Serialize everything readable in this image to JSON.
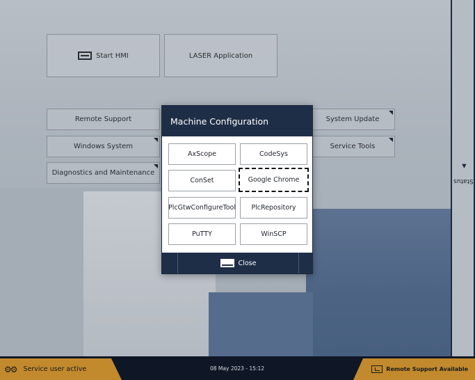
{
  "main_tiles": {
    "start_hmi": "Start HMI",
    "laser_application": "LASER Application"
  },
  "left_menu": {
    "remote_support": "Remote Support",
    "windows_system": "Windows System",
    "diagnostics": "Diagnostics and Maintenance"
  },
  "right_menu": {
    "system_update": "System Update",
    "service_tools": "Service Tools"
  },
  "dialog": {
    "title": "Machine Configuration",
    "buttons": [
      "AxScope",
      "CodeSys",
      "ConSet",
      "Google Chrome",
      "PlcGtwConfigureTool",
      "PlcRepository",
      "PuTTY",
      "WinSCP"
    ],
    "close_label": "Close"
  },
  "side_panel": {
    "status_label": "Status"
  },
  "status_bar": {
    "service_user": "Service user active",
    "datetime": "08 May 2023 - 15:12",
    "remote_support": "Remote Support Available"
  },
  "colors": {
    "accent_orange": "#c28a2d",
    "header_navy": "#1f2e47",
    "bar_dark": "#0f1726"
  }
}
